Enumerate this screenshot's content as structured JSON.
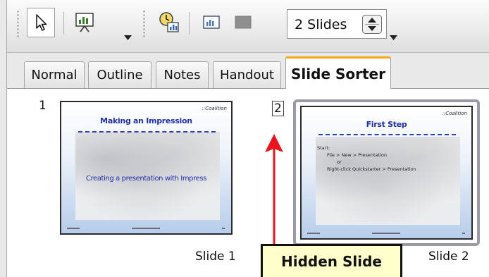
{
  "toolbar": {
    "select_tool_icon": "pointer-arrow-icon",
    "slide_show_icon": "slide-show-icon",
    "slide_transition_icon": "slide-transition-clock-icon",
    "slide_layout_icon": "slide-layout-icon",
    "hide_slide_icon": "hide-slide-gray-icon",
    "slides_per_row": "2 Slides"
  },
  "tabs": [
    {
      "label": "Normal"
    },
    {
      "label": "Outline"
    },
    {
      "label": "Notes"
    },
    {
      "label": "Handout"
    },
    {
      "label": "Slide Sorter",
      "active": true
    }
  ],
  "slides": [
    {
      "number": "1",
      "caption": "Slide 1",
      "logo": "::Coalition",
      "title": "Making an Impression",
      "subtitle": "Creating a presentation with Impress"
    },
    {
      "number": "2",
      "caption": "Slide 2",
      "logo": "::Coalition",
      "title": "First Step",
      "bullets": [
        "Start:",
        "File > New > Presentation",
        "or",
        "Right-click Quickstarter > Presentation"
      ]
    }
  ],
  "callout": {
    "text": "Hidden Slide"
  },
  "colors": {
    "tab_accent": "#f6a81a",
    "slide_title": "#2231a8",
    "callout_bg": "#ffffcc",
    "arrow": "#e8141e"
  }
}
